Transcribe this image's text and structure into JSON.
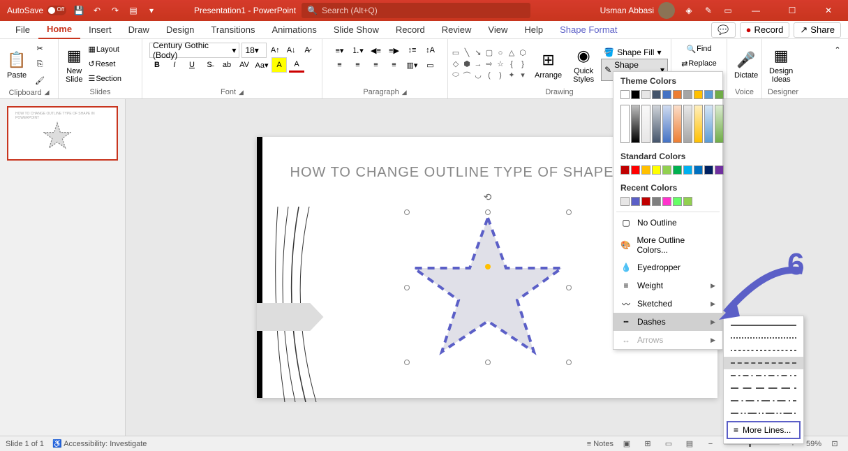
{
  "titlebar": {
    "autosave_label": "AutoSave",
    "autosave_state": "Off",
    "doc_title": "Presentation1 - PowerPoint",
    "search_placeholder": "Search (Alt+Q)",
    "user_name": "Usman Abbasi"
  },
  "tabs": {
    "items": [
      "File",
      "Home",
      "Insert",
      "Draw",
      "Design",
      "Transitions",
      "Animations",
      "Slide Show",
      "Record",
      "Review",
      "View",
      "Help",
      "Shape Format"
    ],
    "active": "Home",
    "record_btn": "Record",
    "share_btn": "Share"
  },
  "ribbon": {
    "clipboard": {
      "paste": "Paste",
      "label": "Clipboard"
    },
    "slides": {
      "new_slide": "New\nSlide",
      "layout": "Layout",
      "reset": "Reset",
      "section": "Section",
      "label": "Slides"
    },
    "font": {
      "family": "Century Gothic (Body)",
      "size": "18",
      "label": "Font"
    },
    "paragraph": {
      "label": "Paragraph"
    },
    "drawing": {
      "arrange": "Arrange",
      "quick_styles": "Quick\nStyles",
      "shape_fill": "Shape Fill",
      "shape_outline": "Shape Outline",
      "label": "Drawing"
    },
    "editing": {
      "find": "Find",
      "replace": "Replace",
      "label": ""
    },
    "voice": {
      "dictate": "Dictate",
      "label": "Voice"
    },
    "designer": {
      "design_ideas": "Design\nIdeas",
      "label": "Designer"
    }
  },
  "slide": {
    "number": "1",
    "title": "HOW TO CHANGE OUTLINE  TYPE OF SHAPE IN POW"
  },
  "outline_menu": {
    "theme_colors": "Theme Colors",
    "standard_colors": "Standard Colors",
    "recent_colors": "Recent Colors",
    "no_outline": "No Outline",
    "more_colors": "More Outline Colors...",
    "eyedropper": "Eyedropper",
    "weight": "Weight",
    "sketched": "Sketched",
    "dashes": "Dashes",
    "arrows": "Arrows",
    "theme_row1": [
      "#ffffff",
      "#000000",
      "#e7e6e6",
      "#44546a",
      "#4472c4",
      "#ed7d31",
      "#a5a5a5",
      "#ffc000",
      "#5b9bd5",
      "#70ad47"
    ],
    "standard_row": [
      "#c00000",
      "#ff0000",
      "#ffc000",
      "#ffff00",
      "#92d050",
      "#00b050",
      "#00b0f0",
      "#0070c0",
      "#002060",
      "#7030a0"
    ],
    "recent_row": [
      "#e7e6e6",
      "#5b5fc7",
      "#c00000",
      "#7f7f7f",
      "#ff33cc",
      "#66ff66",
      "#92d050"
    ]
  },
  "dashes_menu": {
    "more_lines": "More Lines...",
    "styles": [
      "solid",
      "round-dot",
      "square-dot",
      "dash",
      "dash-dot",
      "long-dash",
      "long-dash-dot",
      "long-dash-dot-dot"
    ]
  },
  "annotation": {
    "step": "6"
  },
  "statusbar": {
    "slide_info": "Slide 1 of 1",
    "accessibility": "Accessibility: Investigate",
    "notes": "Notes",
    "zoom": "59%"
  }
}
